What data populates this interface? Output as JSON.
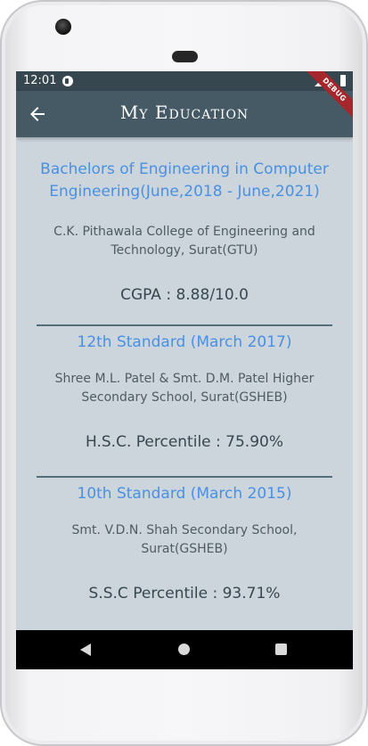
{
  "status_bar": {
    "time": "12:01"
  },
  "app_bar": {
    "title": "My Education",
    "debug_banner": "DEBUG"
  },
  "education": [
    {
      "degree": "Bachelors of Engineering in Computer Engineering(June,2018 - June,2021)",
      "institute": "C.K. Pithawala College of Engineering and Technology, Surat(GTU)",
      "score": "CGPA : 8.88/10.0"
    },
    {
      "degree": "12th Standard (March 2017)",
      "institute": "Shree M.L. Patel & Smt. D.M. Patel Higher Secondary School, Surat(GSHEB)",
      "score": "H.S.C. Percentile : 75.90%"
    },
    {
      "degree": "10th Standard (March 2015)",
      "institute": "Smt. V.D.N. Shah Secondary School, Surat(GSHEB)",
      "score": "S.S.C Percentile : 93.71%"
    }
  ],
  "icons": {
    "back": "arrow-back-icon",
    "nav_back": "nav-back-icon",
    "nav_home": "nav-home-icon",
    "nav_recent": "nav-recents-icon"
  },
  "colors": {
    "app_bar": "#455a64",
    "status_bar": "#37474f",
    "background": "#ccd5dc",
    "degree_text": "#4a90e2",
    "divider": "#546e7a"
  }
}
